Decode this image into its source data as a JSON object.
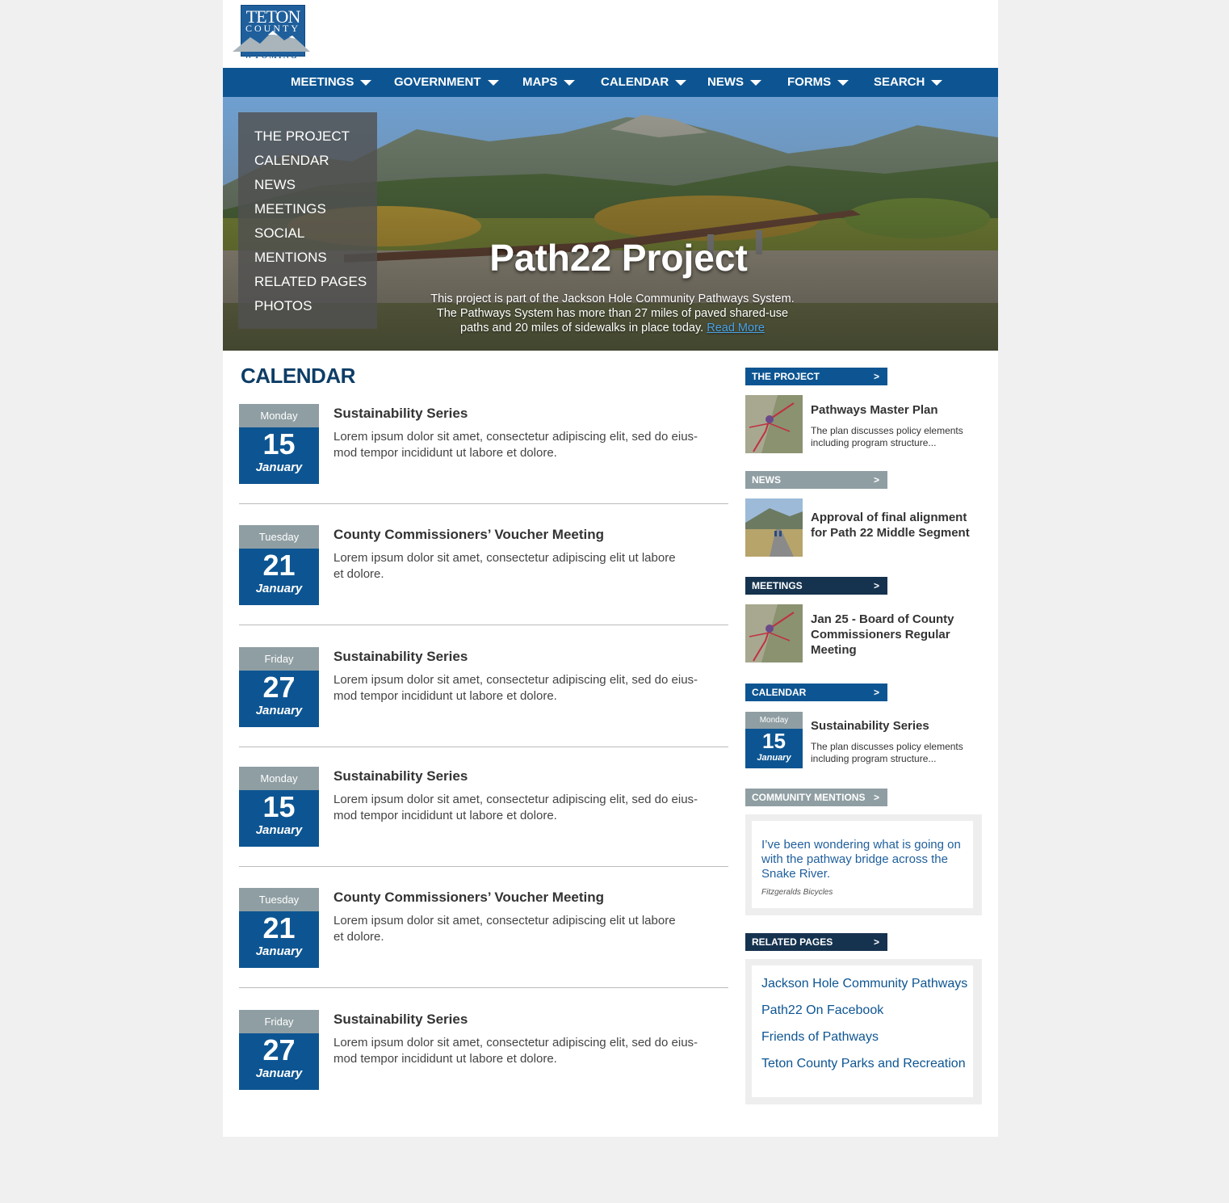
{
  "logo": {
    "line1": "TETON",
    "line2": "COUNTY",
    "line3": "WYOMING"
  },
  "nav": {
    "items": [
      "MEETINGS",
      "GOVERNMENT",
      "MAPS",
      "CALENDAR",
      "NEWS",
      "FORMS",
      "SEARCH"
    ]
  },
  "hero": {
    "side_menu": [
      "THE PROJECT",
      "CALENDAR",
      "NEWS",
      "MEETINGS",
      "SOCIAL",
      "MENTIONS",
      "RELATED PAGES",
      "PHOTOS"
    ],
    "title": "Path22 Project",
    "line1": "This project is part of the Jackson Hole Community Pathways System.",
    "line2": "The Pathways System has more than 27 miles of paved shared-use",
    "line3": "paths and 20 miles of sidewalks in place today.",
    "read_more": "Read More"
  },
  "calendar": {
    "title": "CALENDAR",
    "events": [
      {
        "dow": "Monday",
        "day": "15",
        "month": "January",
        "title": "Sustainability Series",
        "desc1": "Lorem ipsum dolor sit amet, consectetur adipiscing elit, sed do eius-",
        "desc2": "mod tempor incididunt ut labore et dolore."
      },
      {
        "dow": "Tuesday",
        "day": "21",
        "month": "January",
        "title": "County Commissioners’ Voucher Meeting",
        "desc1": "Lorem ipsum dolor sit amet, consectetur adipiscing elit ut labore",
        "desc2": "et dolore."
      },
      {
        "dow": "Friday",
        "day": "27",
        "month": "January",
        "title": "Sustainability Series",
        "desc1": "Lorem ipsum dolor sit amet, consectetur adipiscing elit, sed do eius-",
        "desc2": "mod tempor incididunt ut labore et dolore."
      },
      {
        "dow": "Monday",
        "day": "15",
        "month": "January",
        "title": "Sustainability Series",
        "desc1": "Lorem ipsum dolor sit amet, consectetur adipiscing elit, sed do eius-",
        "desc2": "mod tempor incididunt ut labore et dolore."
      },
      {
        "dow": "Tuesday",
        "day": "21",
        "month": "January",
        "title": "County Commissioners’ Voucher Meeting",
        "desc1": "Lorem ipsum dolor sit amet, consectetur adipiscing elit ut labore",
        "desc2": "et dolore."
      },
      {
        "dow": "Friday",
        "day": "27",
        "month": "January",
        "title": "Sustainability Series",
        "desc1": "Lorem ipsum dolor sit amet, consectetur adipiscing elit, sed do eius-",
        "desc2": "mod tempor incididunt ut labore et dolore."
      }
    ]
  },
  "sidebar": {
    "project": {
      "heading": "THE PROJECT",
      "arrow": ">",
      "title": "Pathways Master Plan",
      "desc1": "The plan discusses policy elements",
      "desc2": "including program structure..."
    },
    "news": {
      "heading": "NEWS",
      "arrow": ">",
      "title1": "Approval of final alignment",
      "title2": "for Path 22 Middle Segment"
    },
    "meetings": {
      "heading": "MEETINGS",
      "arrow": ">",
      "title1": "Jan 25 - Board of County",
      "title2": "Commissioners Regular",
      "title3": "Meeting"
    },
    "calendar": {
      "heading": "CALENDAR",
      "arrow": ">",
      "dow": "Monday",
      "day": "15",
      "month": "January",
      "title": "Sustainability Series",
      "desc1": "The plan discusses policy elements",
      "desc2": "including program structure..."
    },
    "mentions": {
      "heading": "COMMUNITY MENTIONS",
      "arrow": ">",
      "quote1": "I’ve been wondering what is going on",
      "quote2": "with the pathway bridge across the",
      "quote3": "Snake River.",
      "source": "Fitzgeralds Bicycles"
    },
    "related": {
      "heading": "RELATED PAGES",
      "arrow": ">",
      "links": [
        "Jackson Hole Community Pathways",
        "Path22 On Facebook",
        "Friends of Pathways",
        "Teton County Parks and Recreation"
      ]
    }
  },
  "colors": {
    "brand_blue": "#0d5592",
    "dark_navy": "#15334f",
    "gray_header": "#8f9ea3",
    "page_bg": "#f0f0f0"
  }
}
